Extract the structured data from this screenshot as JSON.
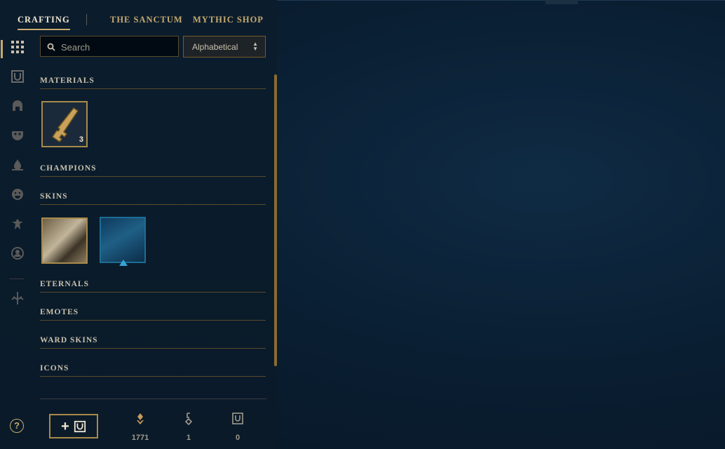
{
  "nav": {
    "tabs": [
      {
        "label": "CRAFTING",
        "active": true
      },
      {
        "label": "THE SANCTUM",
        "active": false
      },
      {
        "label": "MYTHIC SHOP",
        "active": false
      }
    ]
  },
  "sidebar": {
    "icons": [
      "grid-icon",
      "chest-icon",
      "helmet-icon",
      "mask-icon",
      "splash-icon",
      "emote-icon",
      "ward-icon",
      "profile-icon",
      "rune-icon"
    ]
  },
  "search": {
    "placeholder": "Search",
    "value": ""
  },
  "sort": {
    "selected": "Alphabetical"
  },
  "sections": {
    "materials": "MATERIALS",
    "champions": "CHAMPIONS",
    "skins": "SKINS",
    "eternals": "ETERNALS",
    "emotes": "EMOTES",
    "ward_skins": "WARD SKINS",
    "icons": "ICONS"
  },
  "materials": {
    "key_count": "3"
  },
  "currencies": {
    "orange_essence": "1771",
    "keys": "1",
    "chests": "0"
  },
  "help": {
    "label": "?"
  },
  "colors": {
    "gold": "#c8aa6e",
    "text": "#a09b8c",
    "background": "#0a1a29"
  }
}
